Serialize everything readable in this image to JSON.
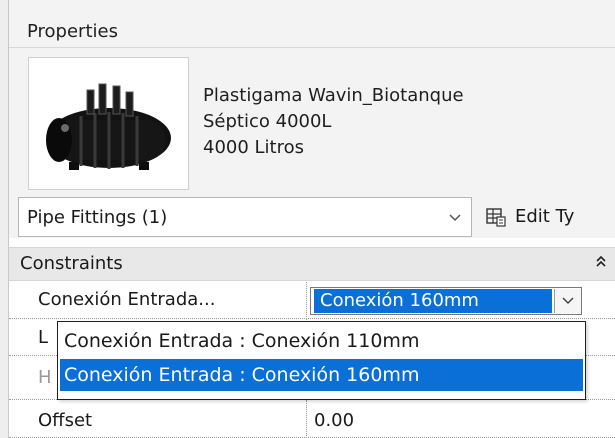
{
  "panel": {
    "title": "Properties"
  },
  "family": {
    "line1": "Plastigama Wavin_Biotanque",
    "line2": "Séptico 4000L",
    "line3": "4000 Litros",
    "thumbnail_icon": "septic-tank-icon"
  },
  "type_selector": {
    "label": "Pipe Fittings (1)",
    "edit_type_label": "Edit Ty",
    "edit_type_icon": "edit-type-icon",
    "chevron_icon": "chevron-down-icon"
  },
  "constraints": {
    "group_label": "Constraints",
    "collapse_icon": "double-chevron-up-icon",
    "rows": [
      {
        "name": "Conexión Entrada...",
        "value": "Conexión 160mm"
      },
      {
        "name": "L",
        "value": ""
      },
      {
        "name": "H",
        "value": ""
      },
      {
        "name": "Offset",
        "value": "0.00"
      }
    ]
  },
  "dropdown": {
    "options": [
      {
        "label": "Conexión Entrada : Conexión 110mm",
        "selected": false
      },
      {
        "label": "Conexión Entrada : Conexión 160mm",
        "selected": true
      }
    ]
  },
  "colors": {
    "selection": "#0a6fd6",
    "panel_bg": "#f3f3f3",
    "group_bg": "#e8e8e8"
  }
}
